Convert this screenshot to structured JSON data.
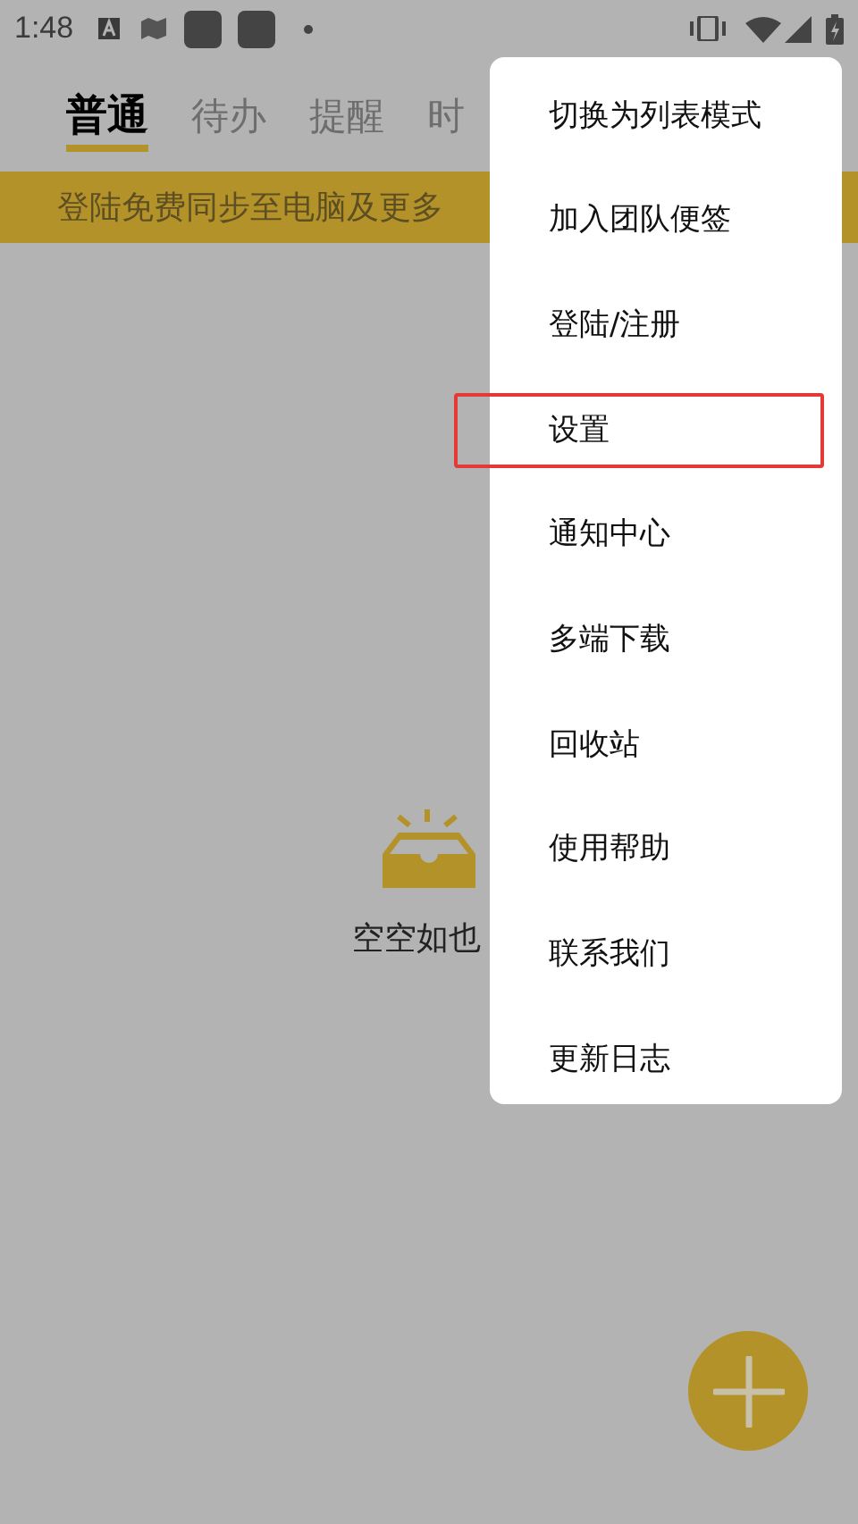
{
  "status_bar": {
    "time": "1:48"
  },
  "tabs": [
    {
      "label": "普通",
      "selected": true
    },
    {
      "label": "待办",
      "selected": false
    },
    {
      "label": "提醒",
      "selected": false
    },
    {
      "label": "时",
      "selected": false
    }
  ],
  "banner": {
    "text": "登陆免费同步至电脑及更多"
  },
  "empty_state": {
    "text": "空空如也"
  },
  "menu": {
    "items": [
      {
        "label": "切换为列表模式",
        "highlighted": false
      },
      {
        "label": "加入团队便签",
        "highlighted": false
      },
      {
        "label": "登陆/注册",
        "highlighted": false
      },
      {
        "label": "设置",
        "highlighted": true
      },
      {
        "label": "通知中心",
        "highlighted": false
      },
      {
        "label": "多端下载",
        "highlighted": false
      },
      {
        "label": "回收站",
        "highlighted": false
      },
      {
        "label": "使用帮助",
        "highlighted": false
      },
      {
        "label": "联系我们",
        "highlighted": false
      },
      {
        "label": "更新日志",
        "highlighted": false
      }
    ]
  }
}
